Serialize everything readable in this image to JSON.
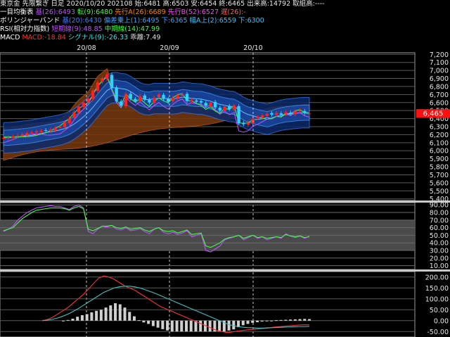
{
  "header": {
    "line1": "東京金 先限繋ぎ 日足 2020/10/20 202108 始:6481 高:6503 安:6454 終:6465 出来高:14792 取組高:----",
    "line2": [
      {
        "text": "一目均衡表",
        "color": "#ffffff"
      },
      {
        "text": "基(26):6493",
        "color": "#c050ff"
      },
      {
        "text": "転(9):6480",
        "color": "#40ff40"
      },
      {
        "text": "先行A(26):6689",
        "color": "#ff8000"
      },
      {
        "text": "先行B(52):6527",
        "color": "#ff40ff"
      },
      {
        "text": "遅(26):-",
        "color": "#ff6060"
      }
    ],
    "line3": [
      {
        "text": "ボリンジャーバンド",
        "color": "#ffffff"
      },
      {
        "text": "基(20):6430",
        "color": "#4080ff"
      },
      {
        "text": "偏差乗上(1):6495",
        "color": "#40a0ff"
      },
      {
        "text": "下:6365",
        "color": "#40a0ff"
      },
      {
        "text": "幅A上(2):6559",
        "color": "#40c0ff"
      },
      {
        "text": "下:6300",
        "color": "#40c0ff"
      }
    ],
    "line4": [
      {
        "text": "RSI(相対力指数)",
        "color": "#ffffff"
      },
      {
        "text": "短期線(9):48.85",
        "color": "#c050ff"
      },
      {
        "text": "中期線(14):47.99",
        "color": "#40ff40"
      }
    ],
    "line5": [
      {
        "text": "MACD",
        "color": "#ffffff"
      },
      {
        "text": "MACD:-18.84",
        "color": "#ff3030"
      },
      {
        "text": "シグナル(9):-26.33",
        "color": "#40e0e0"
      },
      {
        "text": "乖離:7.49",
        "color": "#e0e0e0"
      }
    ]
  },
  "price_label": "6,465",
  "chart_data": [
    {
      "type": "candlestick",
      "x_labels": [
        "20/08",
        "20/09",
        "20/10"
      ],
      "y_ticks": [
        "7,200",
        "7,100",
        "7,000",
        "6,900",
        "6,800",
        "6,700",
        "6,600",
        "6,500",
        "6,400",
        "6,300",
        "6,200",
        "6,100",
        "6,000",
        "5,900",
        "5,800",
        "5,700",
        "5,600",
        "5,500",
        "5,400"
      ],
      "ylim": [
        5380,
        7220
      ],
      "last": 6465,
      "closes": [
        6160,
        6165,
        6175,
        6190,
        6205,
        6220,
        6230,
        6240,
        6248,
        6250,
        6262,
        6280,
        6300,
        6350,
        6400,
        6480,
        6550,
        6600,
        6650,
        6750,
        6850,
        6900,
        6950,
        6780,
        6620,
        6560,
        6700,
        6650,
        6620,
        6680,
        6640,
        6600,
        6660,
        6700,
        6650,
        6610,
        6660,
        6690,
        6700,
        6620,
        6630,
        6610,
        6600,
        6560,
        6600,
        6540,
        6500,
        6550,
        6520,
        6560,
        6340,
        6330,
        6350,
        6400,
        6420,
        6440,
        6460,
        6450,
        6470,
        6450,
        6480,
        6460,
        6490,
        6500,
        6470,
        6465
      ],
      "ichimoku_lag_ref": "-"
    },
    {
      "type": "line",
      "name": "RSI",
      "y_ticks": [
        "90.00",
        "80.00",
        "70.00",
        "60.00",
        "50.00",
        "40.00",
        "30.00",
        "20.00",
        "10.00"
      ],
      "ylim": [
        5,
        93
      ],
      "series": [
        {
          "name": "短期線(9)",
          "color": "#c050ff",
          "values": [
            55,
            58,
            62,
            70,
            75,
            80,
            83,
            86,
            87,
            88,
            89,
            88,
            88,
            86,
            84,
            88,
            90,
            86,
            55,
            52,
            58,
            62,
            61,
            63,
            58,
            57,
            60,
            56,
            57,
            59,
            55,
            52,
            58,
            60,
            54,
            52,
            54,
            51,
            53,
            56,
            48,
            50,
            52,
            30,
            28,
            32,
            36,
            44,
            46,
            48,
            50,
            44,
            47,
            50,
            46,
            48,
            44,
            46,
            48,
            46,
            52,
            49,
            47,
            49,
            46,
            49
          ]
        },
        {
          "name": "中期線(14)",
          "color": "#40ff40",
          "values": [
            56,
            58,
            60,
            66,
            72,
            76,
            80,
            83,
            84,
            85,
            86,
            86,
            86,
            85,
            83,
            86,
            88,
            85,
            58,
            56,
            59,
            62,
            62,
            63,
            60,
            59,
            61,
            58,
            59,
            60,
            57,
            55,
            58,
            60,
            56,
            55,
            56,
            53,
            55,
            57,
            51,
            52,
            53,
            36,
            34,
            37,
            40,
            45,
            47,
            48,
            50,
            46,
            48,
            50,
            47,
            48,
            46,
            47,
            48,
            47,
            51,
            49,
            48,
            49,
            47,
            48
          ]
        }
      ]
    },
    {
      "type": "bar+line",
      "name": "MACD",
      "y_ticks": [
        "200.00",
        "150.00",
        "100.00",
        "50.00",
        "0.00",
        "-50.00"
      ],
      "ylim": [
        -75,
        225
      ],
      "series": [
        {
          "name": "MACD",
          "color": "#ff3030",
          "values": [
            0,
            5,
            15,
            30,
            45,
            60,
            80,
            100,
            120,
            145,
            170,
            195,
            205,
            200,
            190,
            175,
            160,
            150,
            140,
            125,
            110,
            95,
            80,
            65,
            55,
            45,
            35,
            25,
            15,
            5,
            -5,
            -15,
            -25,
            -35,
            -45,
            -50,
            -55,
            -52,
            -48,
            -45,
            -42,
            -40,
            -38,
            -36,
            -34,
            -30,
            -28,
            -26,
            -24,
            -22,
            -20,
            -19,
            -19
          ]
        },
        {
          "name": "シグナル(9)",
          "color": "#40c0c0",
          "values": [
            0,
            2,
            6,
            12,
            20,
            30,
            42,
            55,
            70,
            85,
            100,
            115,
            130,
            140,
            150,
            155,
            158,
            158,
            155,
            150,
            142,
            134,
            125,
            115,
            105,
            95,
            85,
            75,
            65,
            55,
            45,
            35,
            25,
            15,
            5,
            -5,
            -15,
            -22,
            -27,
            -30,
            -32,
            -33,
            -34,
            -34,
            -33,
            -32,
            -31,
            -30,
            -29,
            -28,
            -27,
            -27,
            -26
          ]
        },
        {
          "name": "乖離",
          "color": "#d0d0d0",
          "values": [
            0,
            3,
            9,
            18,
            25,
            30,
            38,
            45,
            50,
            60,
            70,
            80,
            75,
            60,
            40,
            20,
            2,
            -8,
            -15,
            -25,
            -32,
            -39,
            -45,
            -50,
            -50,
            -50,
            -50,
            -50,
            -50,
            -50,
            -50,
            -50,
            -50,
            -50,
            -50,
            -45,
            -40,
            -30,
            -21,
            -15,
            -10,
            -7,
            -4,
            -2,
            -1,
            2,
            3,
            4,
            5,
            6,
            7,
            8,
            7
          ]
        }
      ]
    }
  ]
}
